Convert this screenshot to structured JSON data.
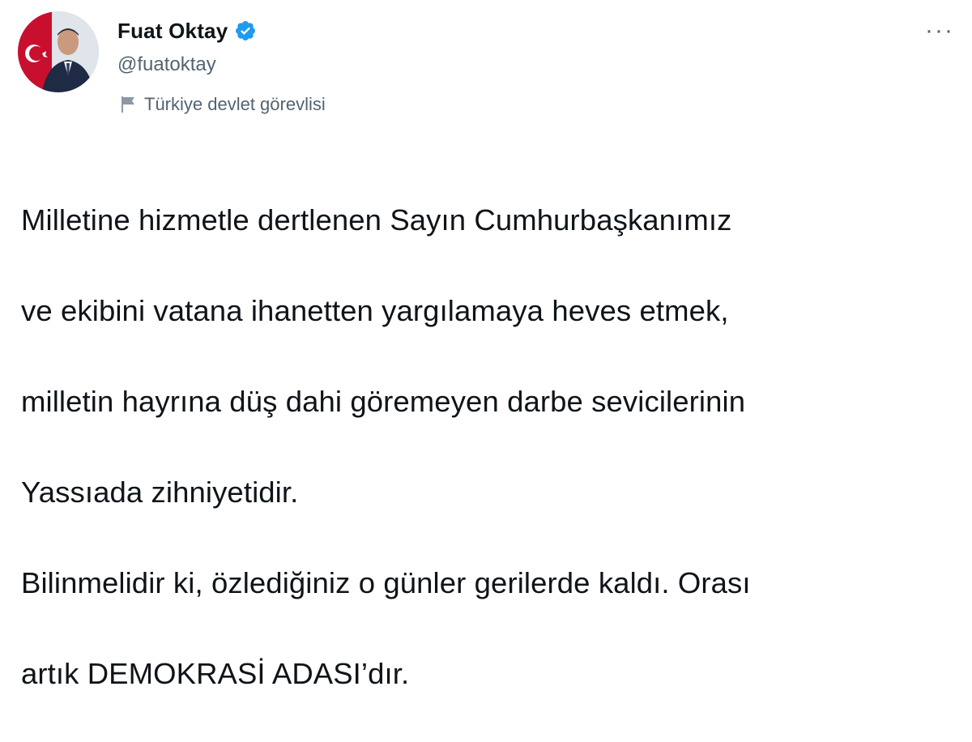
{
  "author": {
    "display_name": "Fuat Oktay",
    "handle": "@fuatoktay",
    "verified": true,
    "avatar": "profile-photo"
  },
  "account_label": {
    "icon": "flag-icon",
    "text": "Türkiye devlet görevlisi"
  },
  "menu": {
    "icon": "more-options-icon",
    "glyph": "···"
  },
  "tweet": {
    "lines": [
      "Milletine hizmetle dertlenen Sayın Cumhurbaşkanımız",
      "ve ekibini vatana ihanetten yargılamaya heves etmek,",
      "milletin hayrına düş dahi göremeyen darbe sevicilerinin",
      "Yassıada zihniyetidir.",
      "Bilinmelidir ki, özlediğiniz o günler gerilerde kaldı. Orası",
      "artık DEMOKRASİ ADASI’dır."
    ]
  },
  "colors": {
    "verified_badge": "#1d9bf0",
    "secondary_text": "#536471",
    "primary_text": "#0f1419"
  }
}
